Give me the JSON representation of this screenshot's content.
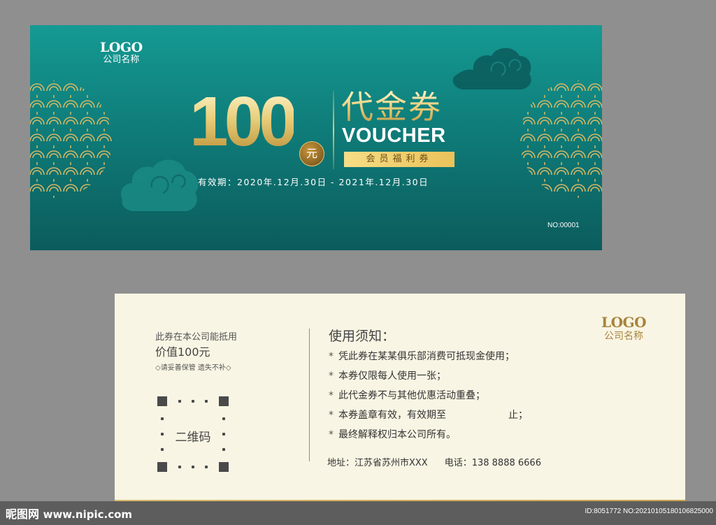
{
  "front": {
    "logo": "LOGO",
    "company": "公司名称",
    "amount": "100",
    "currency": "元",
    "title_cn": "代金券",
    "title_en": "VOUCHER",
    "badge": "会员福利券",
    "validity": "有效期：2020年.12月.30日 - 2021年.12月.30日",
    "serial": "NO:00001",
    "colors": {
      "teal_top": "#159a93",
      "teal_bottom": "#0b5c5c",
      "gold": "#e7c878"
    }
  },
  "back": {
    "line1": "此券在本公司能抵用",
    "line2": "价值100元",
    "line3": "◇请妥善保管 遗失不补◇",
    "qr_label": "二维码",
    "usage_title": "使用须知：",
    "rules": [
      "凭此券在某某俱乐部消费可抵现金使用；",
      "本券仅限每人使用一张；",
      "此代金券不与其他优惠活动重叠；",
      "本券盖章有效，有效期至                    止；",
      "最终解释权归本公司所有。"
    ],
    "address": "地址：江苏省苏州市XXX",
    "phone": "电话：138 8888 6666",
    "logo": "LOGO",
    "company": "公司名称",
    "colors": {
      "paper": "#f9f5e4",
      "logo_gold": "#a7843c"
    }
  },
  "watermark": {
    "site": "昵图网",
    "url": "www.nipic.com",
    "id": "ID:8051772 NO:20210105180106825000"
  }
}
